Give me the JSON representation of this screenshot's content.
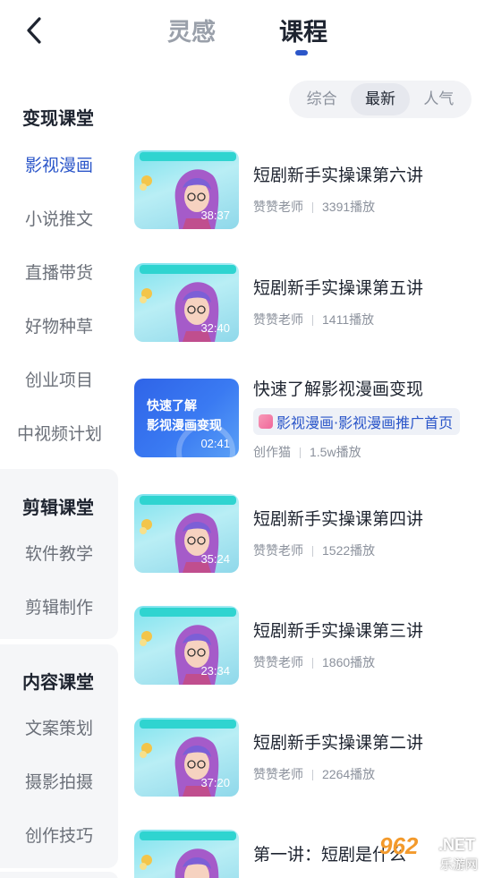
{
  "header": {
    "back_icon": "chevron-left-icon",
    "tabs": [
      {
        "label": "灵感",
        "active": false
      },
      {
        "label": "课程",
        "active": true
      }
    ],
    "accent_color": "#2b56c9"
  },
  "sort": {
    "options": [
      "综合",
      "最新",
      "人气"
    ],
    "selected": "最新"
  },
  "sidebar": {
    "groups": [
      {
        "title": "变现课堂",
        "items": [
          "影视漫画",
          "小说推文",
          "直播带货",
          "好物种草",
          "创业项目",
          "中视频计划"
        ],
        "active_item": "影视漫画"
      },
      {
        "title": "剪辑课堂",
        "items": [
          "软件教学",
          "剪辑制作"
        ]
      },
      {
        "title": "内容课堂",
        "items": [
          "文案策划",
          "摄影拍摄",
          "创作技巧"
        ]
      }
    ]
  },
  "courses": [
    {
      "title": "短剧新手实操课第六讲",
      "author": "赞赞老师",
      "plays": "3391播放",
      "duration": "38:37",
      "thumb": "girl-avatar"
    },
    {
      "title": "短剧新手实操课第五讲",
      "author": "赞赞老师",
      "plays": "1411播放",
      "duration": "32:40",
      "thumb": "girl-avatar"
    },
    {
      "title": "快速了解影视漫画变现",
      "tag": "影视漫画·影视漫画推广首页",
      "author": "创作猫",
      "plays": "1.5w播放",
      "duration": "02:41",
      "thumb": "blue-card",
      "thumb_text": [
        "快速了解",
        "影视漫画变现"
      ]
    },
    {
      "title": "短剧新手实操课第四讲",
      "author": "赞赞老师",
      "plays": "1522播放",
      "duration": "35:24",
      "thumb": "girl-avatar"
    },
    {
      "title": "短剧新手实操课第三讲",
      "author": "赞赞老师",
      "plays": "1860播放",
      "duration": "23:34",
      "thumb": "girl-avatar"
    },
    {
      "title": "短剧新手实操课第二讲",
      "author": "赞赞老师",
      "plays": "2264播放",
      "duration": "37:20",
      "thumb": "girl-avatar"
    },
    {
      "title": "第一讲：短剧是什么",
      "thumb": "girl-avatar"
    }
  ],
  "watermark": {
    "number": "962",
    "domain": ".NET",
    "subtitle": "乐游网"
  }
}
